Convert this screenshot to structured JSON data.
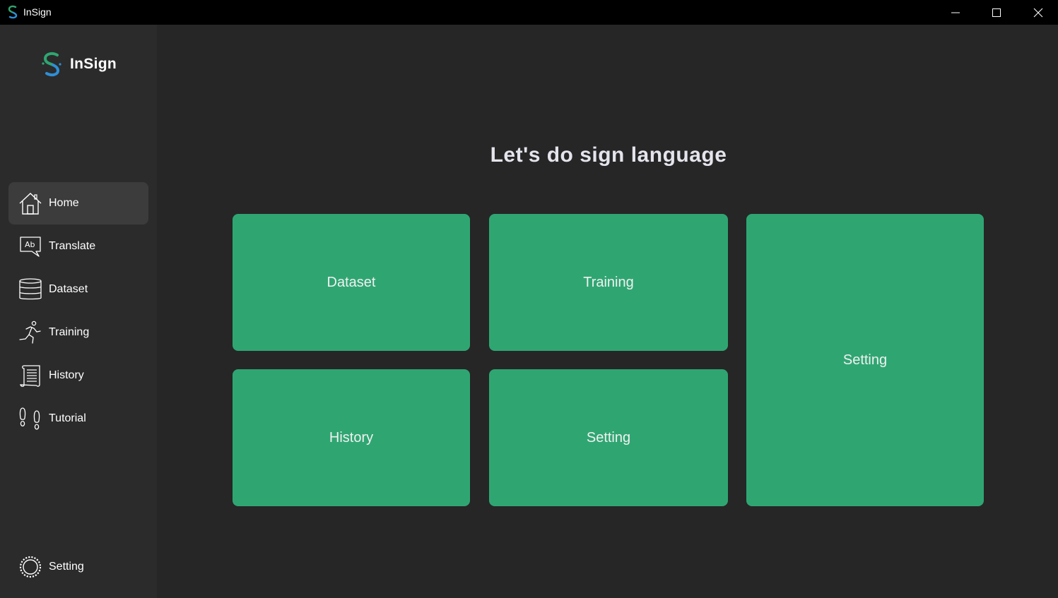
{
  "window": {
    "title": "InSign",
    "minimize_icon": "minimize-icon",
    "maximize_icon": "maximize-icon",
    "close_icon": "close-icon"
  },
  "brand": {
    "name": "InSign",
    "logo": "insign-logo",
    "logo_colors": [
      "#2fa672",
      "#2e8fd6"
    ]
  },
  "sidebar": {
    "items": [
      {
        "label": "Home",
        "icon": "home-icon",
        "active": true
      },
      {
        "label": "Translate",
        "icon": "translate-icon",
        "active": false
      },
      {
        "label": "Dataset",
        "icon": "database-icon",
        "active": false
      },
      {
        "label": "Training",
        "icon": "running-icon",
        "active": false
      },
      {
        "label": "History",
        "icon": "scroll-icon",
        "active": false
      },
      {
        "label": "Tutorial",
        "icon": "footsteps-icon",
        "active": false
      }
    ],
    "footer": {
      "label": "Setting",
      "icon": "gear-icon"
    }
  },
  "main": {
    "heading": "Let's do sign language",
    "tiles": [
      {
        "label": "Dataset"
      },
      {
        "label": "Training"
      },
      {
        "label": "Setting"
      },
      {
        "label": "History"
      },
      {
        "label": "Setting"
      }
    ]
  },
  "colors": {
    "accent": "#2fa672",
    "titlebar": "#000000",
    "sidebar": "#2b2b2b",
    "background": "#262626",
    "active_item": "#3c3c3c"
  }
}
